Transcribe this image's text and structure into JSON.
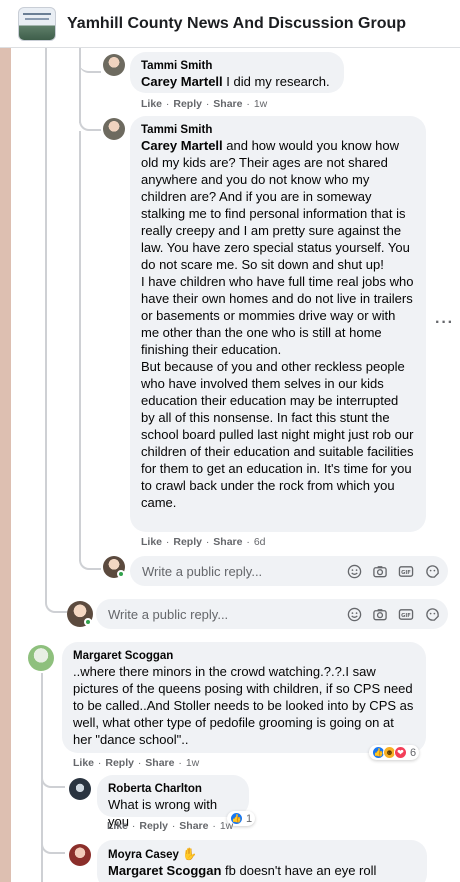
{
  "group": {
    "title": "Yamhill County News And Discussion Group"
  },
  "comments": [
    {
      "author": "Tammi Smith",
      "mention": "Carey Martell",
      "text": " I did my research.",
      "actions": {
        "like": "Like",
        "reply": "Reply",
        "share": "Share",
        "age": "1w"
      }
    },
    {
      "author": "Tammi Smith",
      "mention": "Carey Martell",
      "text": " and how would you know how old my kids are? Their ages are not shared anywhere and you do not know who my children are? And if you are in someway stalking me to find personal information that is really creepy and I am pretty sure against the law. You have zero special status yourself. You do not scare me. So sit down and shut up!\nI have children who have full time real jobs who have their own homes and do not live in trailers or basements or mommies drive way or with me other than the one who is still at home finishing their education.\nBut because of you and other reckless people who have involved them selves in our kids education their education may be interrupted by all of this nonsense. In fact this stunt the school board pulled last night might just rob our children of their education and suitable facilities for them to get an education in. It's time for you to crawl back under the rock from which you came.",
      "actions": {
        "like": "Like",
        "reply": "Reply",
        "share": "Share",
        "age": "6d"
      },
      "more": "···"
    },
    {
      "author": "Margaret Scoggan",
      "text": "..where there minors in the crowd watching.?.?.I saw pictures of the queens posing with children, if so CPS need to be called..And Stoller needs to be looked into by CPS as well, what other type of pedofile grooming is going on at her \"dance school\"..",
      "actions": {
        "like": "Like",
        "reply": "Reply",
        "share": "Share",
        "age": "1w"
      },
      "reaction_count": "6"
    },
    {
      "author": "Roberta Charlton",
      "text": "What is wrong with you",
      "actions": {
        "like": "Like",
        "reply": "Reply",
        "share": "Share",
        "age": "1w"
      },
      "reaction_count": "1"
    },
    {
      "author": "Moyra Casey",
      "mention": "Margaret Scoggan",
      "text": " fb doesn't have an eye roll"
    }
  ],
  "reply_placeholder_1": "Write a public reply...",
  "reply_placeholder_2": "Write a public reply...",
  "icons": [
    "emoji-icon",
    "camera-icon",
    "gif-icon",
    "sticker-icon"
  ]
}
